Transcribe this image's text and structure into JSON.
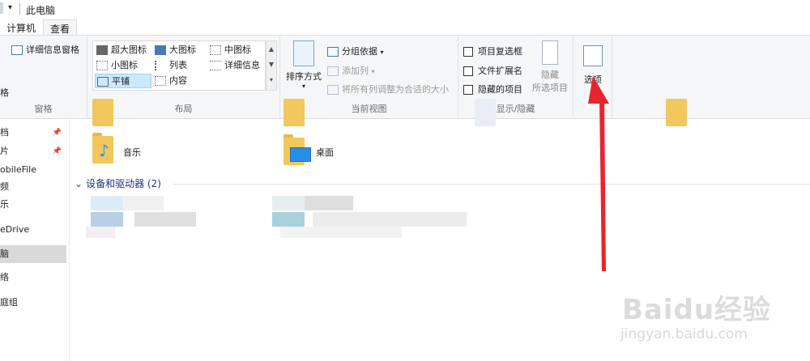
{
  "window": {
    "title": "此电脑"
  },
  "tabs": [
    {
      "label": "计算机"
    },
    {
      "label": "查看"
    }
  ],
  "ribbon": {
    "pane_group": {
      "details_pane": "详细信息窗格",
      "cut_label": "格",
      "group_label": "窗格"
    },
    "layout_group": {
      "items": [
        {
          "label": "超大图标",
          "selected": false
        },
        {
          "label": "大图标",
          "selected": false
        },
        {
          "label": "中图标",
          "selected": false
        },
        {
          "label": "小图标",
          "selected": false
        },
        {
          "label": "列表",
          "selected": false
        },
        {
          "label": "详细信息",
          "selected": false
        },
        {
          "label": "平铺",
          "selected": true
        },
        {
          "label": "内容",
          "selected": false
        }
      ],
      "group_label": "布局"
    },
    "current_view_group": {
      "sort_by": "排序方式",
      "group_by": "分组依据",
      "add_column": "添加列",
      "fit_columns": "将所有列调整为合适的大小",
      "group_label": "当前视图"
    },
    "show_hide_group": {
      "item_checkboxes": "项目复选框",
      "file_extensions": "文件扩展名",
      "hidden_items": "隐藏的项目",
      "hide_selected_line1": "隐藏",
      "hide_selected_line2": "所选项目",
      "group_label": "显示/隐藏"
    },
    "options": {
      "label": "选项"
    }
  },
  "nav": {
    "items": [
      {
        "label": "档",
        "pinned": true
      },
      {
        "label": "片",
        "pinned": true
      },
      {
        "label": "obileFile",
        "pinned": false
      },
      {
        "label": "频",
        "pinned": false
      },
      {
        "label": "乐",
        "pinned": false
      },
      {
        "label": "eDrive",
        "pinned": false
      },
      {
        "label": "脑",
        "pinned": false,
        "selected": true
      },
      {
        "label": "络",
        "pinned": false
      },
      {
        "label": "庭组",
        "pinned": false
      }
    ]
  },
  "content": {
    "folders": [
      {
        "label": "音乐"
      },
      {
        "label": "桌面"
      }
    ],
    "devices_header": "设备和驱动器 (2)"
  },
  "watermark": {
    "brand": "Baidu经验",
    "site": "jingyan.baidu.com"
  },
  "colors": {
    "accent": "#1e3287",
    "selection": "#cce8ff",
    "arrow": "#e8242e"
  }
}
